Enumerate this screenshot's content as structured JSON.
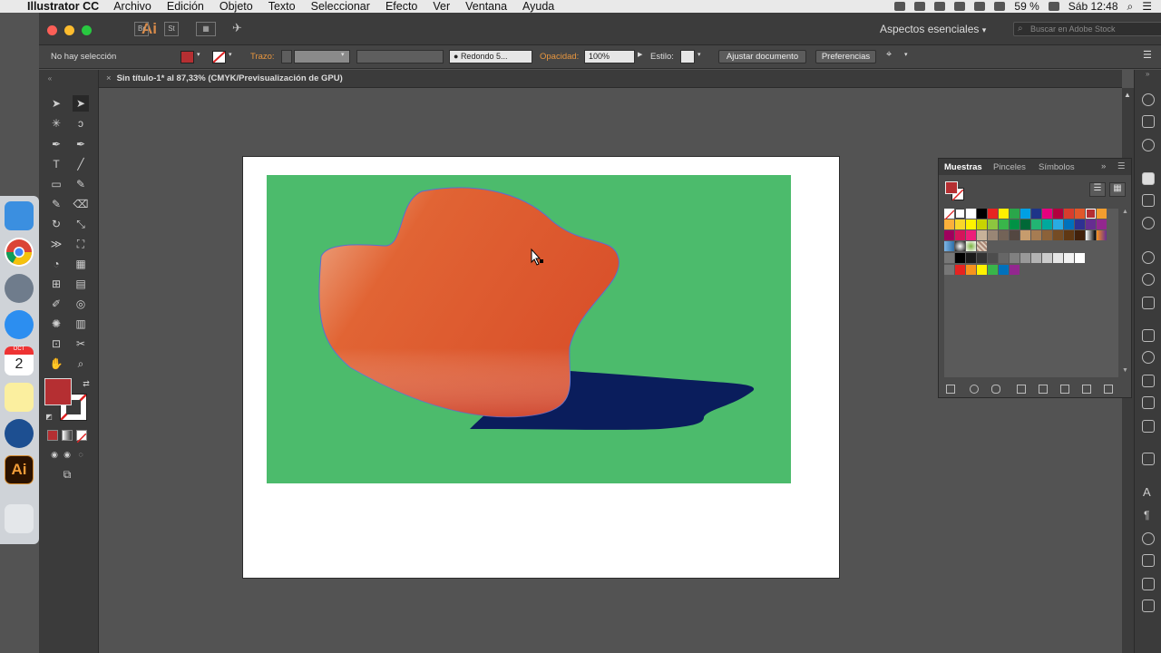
{
  "menubar": {
    "app_name": "Illustrator CC",
    "items": [
      "Archivo",
      "Edición",
      "Objeto",
      "Texto",
      "Seleccionar",
      "Efecto",
      "Ver",
      "Ventana",
      "Ayuda"
    ],
    "battery": "59 %",
    "clock": "Sáb 12:48"
  },
  "appbar": {
    "ai_label": "Ai",
    "br_label": "Br",
    "st_label": "St",
    "workspace": "Aspectos esenciales",
    "stock_search_placeholder": "Buscar en Adobe Stock"
  },
  "control_bar": {
    "selection_status": "No hay selección",
    "stroke_label": "Trazo:",
    "brush_label": "Redondo 5...",
    "opacity_label": "Opacidad:",
    "opacity_value": "100%",
    "style_label": "Estilo:",
    "fit_button": "Ajustar documento",
    "prefs_button": "Preferencias",
    "fill_color": "#b52f32"
  },
  "document": {
    "tab_close": "×",
    "tab_title": "Sin título-1* al 87,33% (CMYK/Previsualización de GPU)"
  },
  "artwork": {
    "background_color": "#4cbb6c",
    "shape_color": "#e0572a",
    "shadow_color": "#0a1d5c"
  },
  "swatches_panel": {
    "tabs": [
      "Muestras",
      "Pinceles",
      "Símbolos"
    ],
    "active_tab": "Muestras"
  },
  "dock": {
    "calendar_month": "OCT",
    "calendar_day": "2",
    "ai_label": "Ai"
  }
}
